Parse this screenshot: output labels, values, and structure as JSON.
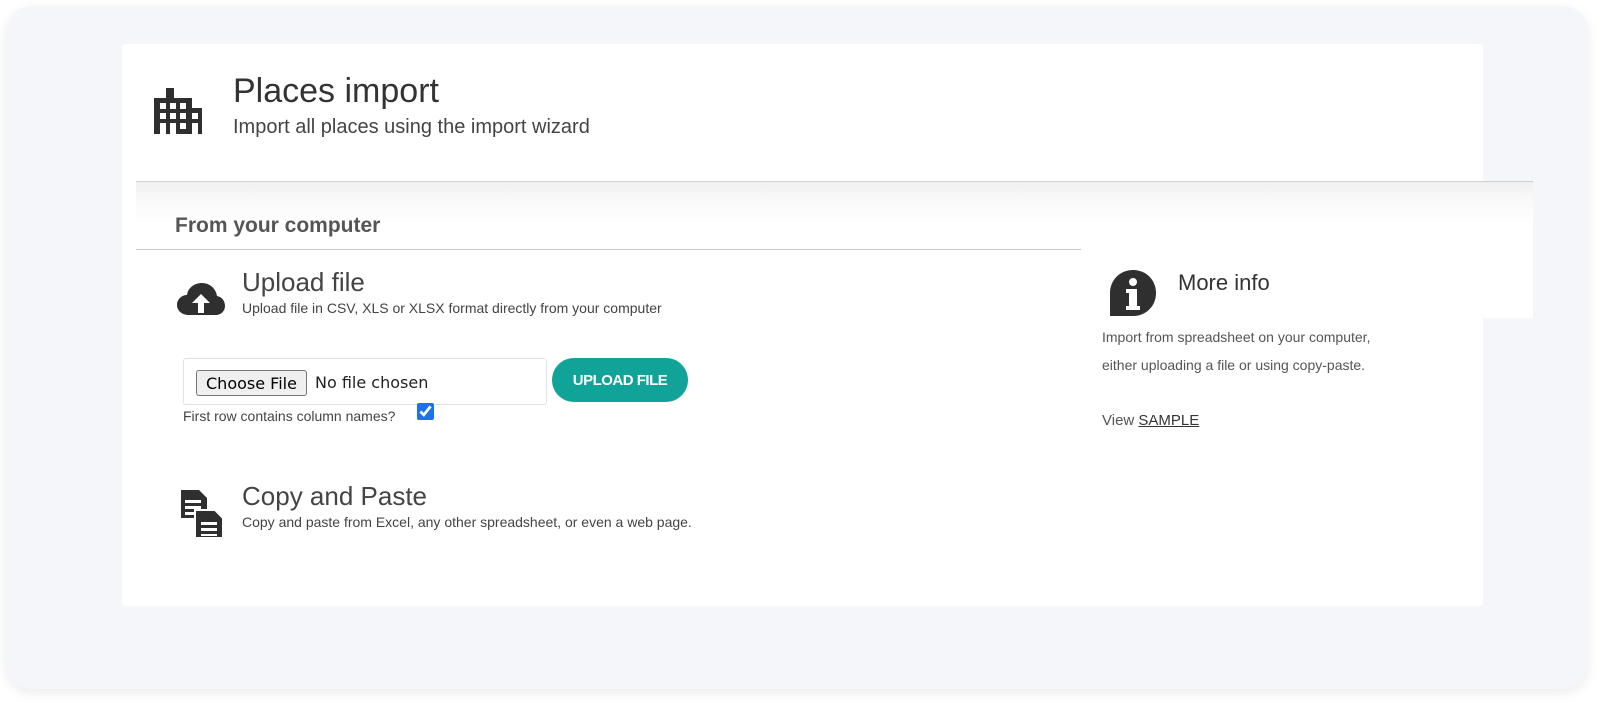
{
  "header": {
    "title": "Places import",
    "subtitle": "Import all places using the import wizard",
    "icon": "building-icon"
  },
  "section": {
    "title": "From your computer"
  },
  "upload": {
    "icon": "cloud-upload-icon",
    "title": "Upload file",
    "description": "Upload file in CSV, XLS or XLSX format directly from your computer",
    "choose_label": "Choose File",
    "no_file_text": "No file chosen",
    "button_label": "UPLOAD FILE",
    "first_row_label": "First row contains column names?",
    "first_row_checked": true
  },
  "paste": {
    "icon": "copy-paste-icon",
    "title": "Copy and Paste",
    "description": "Copy and paste from Excel, any other spreadsheet, or even a web page."
  },
  "info": {
    "icon": "info-icon",
    "title": "More info",
    "line1": "Import from spreadsheet on your computer,",
    "line2": "either uploading a file or using copy-paste.",
    "view_label": "View",
    "sample_link": "SAMPLE"
  },
  "colors": {
    "accent": "#12a398",
    "background": "#f5f6fa",
    "card": "#ffffff"
  }
}
